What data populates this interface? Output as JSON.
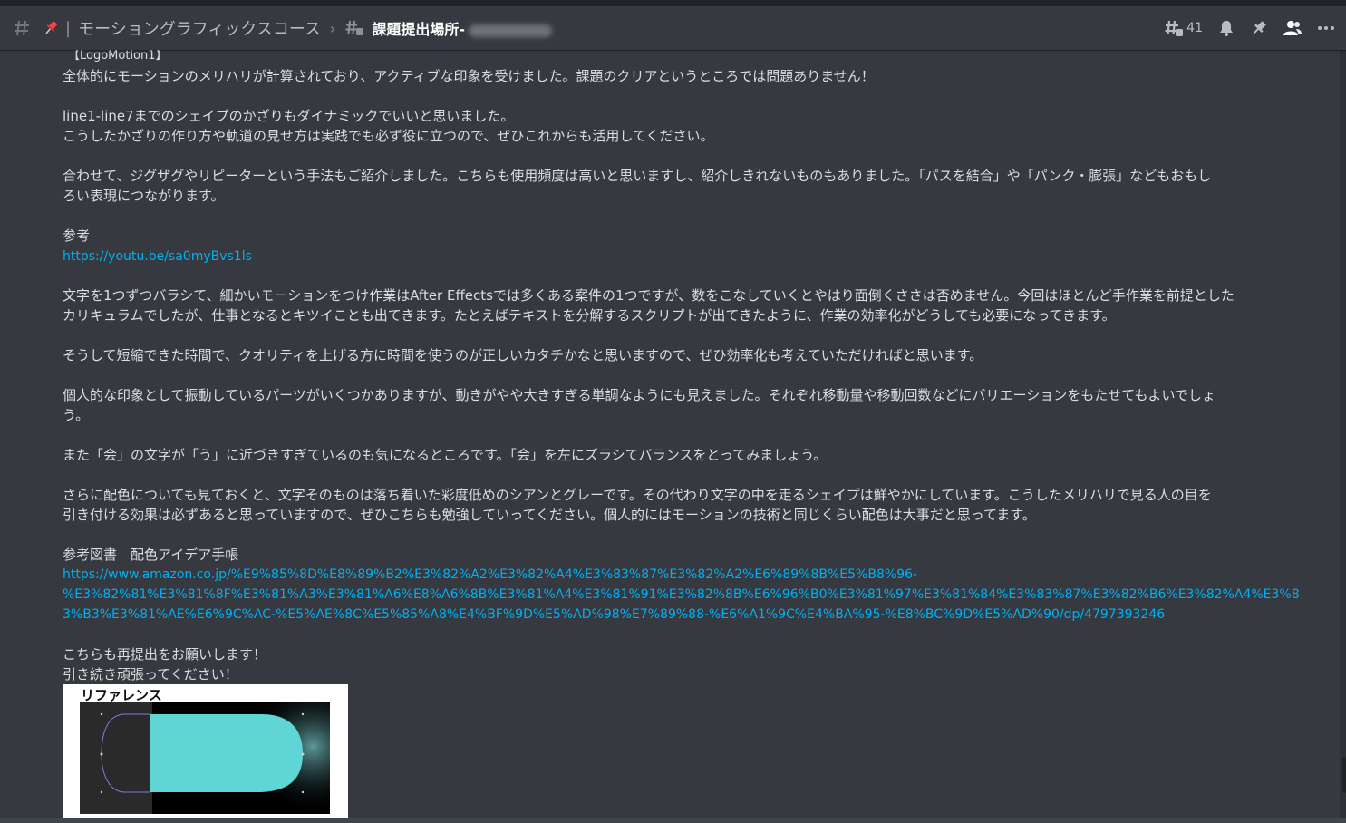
{
  "header": {
    "channel_name": "モーショングラフィックスコース",
    "thread_name": "課題提出場所-",
    "thread_count": "41"
  },
  "message": {
    "lines": [
      "【LogoMotion1】",
      "全体的にモーションのメリハリが計算されており、アクティブな印象を受けました。課題のクリアというところでは問題ありません！",
      "",
      "line1-line7までのシェイプのかざりもダイナミックでいいと思いました。",
      "こうしたかざりの作り方や軌道の見せ方は実践でも必ず役に立つので、ぜひこれからも活用してください。",
      "",
      "合わせて、ジグザグやリピーターという手法もご紹介しました。こちらも使用頻度は高いと思いますし、紹介しきれないものもありました。「パスを結合」や「パンク・膨張」などもおもし",
      "ろい表現につながります。",
      "",
      "参考"
    ],
    "link1": "https://youtu.be/sa0myBvs1ls",
    "lines2": [
      "",
      "文字を1つずつバラシて、細かいモーションをつけ作業はAfter Effectsでは多くある案件の1つですが、数をこなしていくとやはり面倒くささは否めません。今回はほとんど手作業を前提とした",
      "カリキュラムでしたが、仕事となるとキツイことも出てきます。たとえばテキストを分解するスクリプトが出てきたように、作業の効率化がどうしても必要になってきます。",
      "",
      "そうして短縮できた時間で、クオリティを上げる方に時間を使うのが正しいカタチかなと思いますので、ぜひ効率化も考えていただければと思います。",
      "",
      "個人的な印象として振動しているパーツがいくつかありますが、動きがやや大きすぎる単調なようにも見えました。それぞれ移動量や移動回数などにバリエーションをもたせてもよいでしょ",
      "う。",
      "",
      "また「会」の文字が「う」に近づきすぎているのも気になるところです。「会」を左にズラシてバランスをとってみましょう。",
      "",
      "さらに配色についても見ておくと、文字そのものは落ち着いた彩度低めのシアンとグレーです。その代わり文字の中を走るシェイプは鮮やかにしています。こうしたメリハリで見る人の目を",
      "引き付ける効果は必ずあると思っていますので、ぜひこちらも勉強していってください。個人的にはモーションの技術と同じくらい配色は大事だと思ってます。",
      "",
      "参考図書　配色アイデア手帳"
    ],
    "link2_lines": [
      "https://www.amazon.co.jp/%E9%85%8D%E8%89%B2%E3%82%A2%E3%82%A4%E3%83%87%E3%82%A2%E6%89%8B%E5%B8%96-",
      "%E3%82%81%E3%81%8F%E3%81%A3%E3%81%A6%E8%A6%8B%E3%81%A4%E3%81%91%E3%82%8B%E6%96%B0%E3%81%97%E3%81%84%E3%83%87%E3%82%B6%E3%82%A4%E3%8",
      "3%B3%E3%81%AE%E6%9C%AC-%E5%AE%8C%E5%85%A8%E4%BF%9D%E5%AD%98%E7%89%88-%E6%A1%9C%E4%BA%95-%E8%BC%9D%E5%AD%90/dp/4797393246"
    ],
    "lines3": [
      "",
      "こちらも再提出をお願いします！",
      "引き続き頑張ってください！"
    ]
  },
  "attachment": {
    "title": "リファレンス"
  },
  "colors": {
    "background": "#36393f",
    "text": "#dcddde",
    "link": "#00b0f4",
    "pin": "#f04747",
    "shape_fill": "#5fd5d5"
  }
}
